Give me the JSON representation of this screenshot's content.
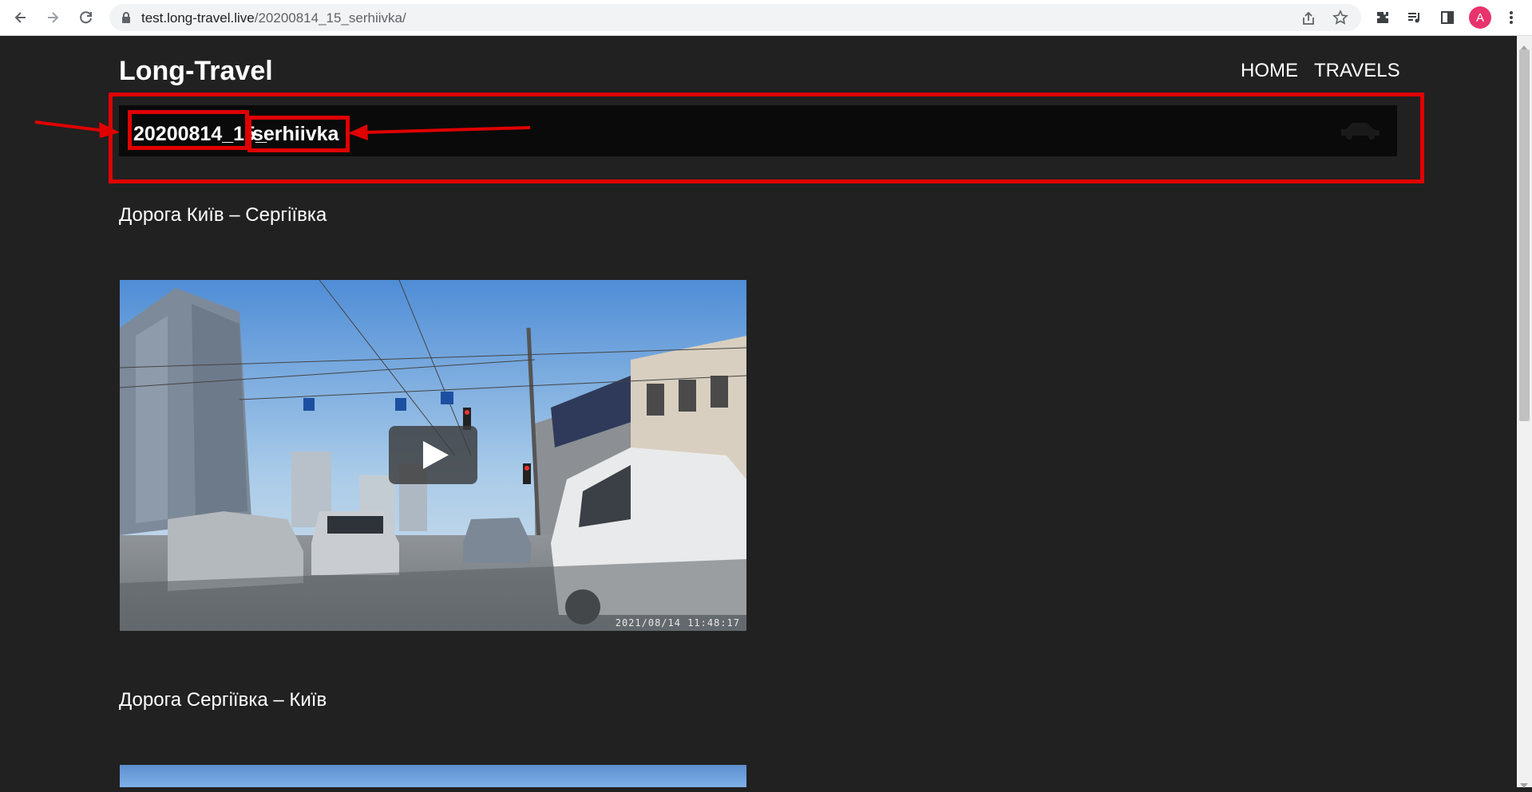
{
  "browser": {
    "url_host": "test.long-travel.live",
    "url_path": "/20200814_15_serhiivka/",
    "avatar_letter": "A"
  },
  "site": {
    "title": "Long-Travel",
    "nav": [
      "HOME",
      "TRAVELS"
    ]
  },
  "post": {
    "title_part1": "20200814_15_",
    "title_part2": "serhiivka"
  },
  "sections": [
    {
      "heading": "Дорога Київ – Сергіївка",
      "video_timestamp": "2021/08/14 11:48:17"
    },
    {
      "heading": "Дорога Сергіївка – Київ"
    }
  ],
  "colors": {
    "page_bg": "#212121",
    "title_bar_bg": "#0a0a0a",
    "annotation": "#e00000",
    "avatar": "#e8336d"
  }
}
